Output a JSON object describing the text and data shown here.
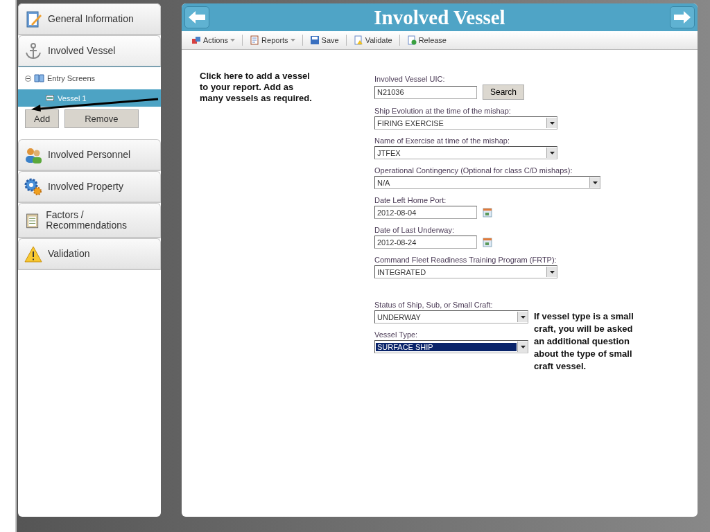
{
  "sidebar": {
    "sections": [
      {
        "label": "General Information",
        "expanded": false
      },
      {
        "label": "Involved Vessel",
        "expanded": true,
        "tree": {
          "label": "Entry Screens",
          "expanded": true,
          "children": [
            {
              "label": "Vessel 1",
              "selected": true
            }
          ]
        },
        "buttons": [
          "Add",
          "Remove"
        ]
      },
      {
        "label": "Involved Personnel",
        "expanded": false
      },
      {
        "label": "Involved Property",
        "expanded": false
      },
      {
        "label": "Factors / Recommendations",
        "expanded": false
      },
      {
        "label": "Validation",
        "expanded": false
      }
    ]
  },
  "header": {
    "title": "Involved Vessel"
  },
  "toolbar": [
    {
      "label": "Actions",
      "dropdown": true
    },
    {
      "label": "Reports",
      "dropdown": true
    },
    {
      "label": "Save",
      "dropdown": false
    },
    {
      "label": "Validate",
      "dropdown": false
    },
    {
      "label": "Release",
      "dropdown": false
    }
  ],
  "callout": "Click here to add a vessel to your report. Add as many vessels as required.",
  "form": {
    "fields": [
      {
        "kind": "search",
        "label": "Involved Vessel UIC:",
        "value": "N21036",
        "button": "Search"
      },
      {
        "kind": "select",
        "label": "Ship Evolution at the time of the mishap:",
        "value": "FIRING EXERCISE",
        "focused": false
      },
      {
        "kind": "select",
        "label": "Name of Exercise at time of the mishap:",
        "value": "JTFEX",
        "focused": false
      },
      {
        "kind": "select",
        "label": "Operational Contingency (Optional for class C/D mishaps):",
        "value": "N/A",
        "focused": false
      },
      {
        "kind": "date",
        "label": "Date Left Home Port:",
        "value": "2012-08-04"
      },
      {
        "kind": "date",
        "label": "Date of Last Underway:",
        "value": "2012-08-24"
      },
      {
        "kind": "select",
        "label": "Command Fleet Readiness Training Program (FRTP):",
        "value": "INTEGRATED",
        "focused": false
      }
    ],
    "group": {
      "fields": [
        {
          "kind": "select",
          "label": "Status of Ship, Sub, or Small Craft:",
          "value": "UNDERWAY",
          "focused": false
        },
        {
          "kind": "select",
          "label": "Vessel Type:",
          "value": "SURFACE SHIP",
          "focused": true
        }
      ],
      "note": "If vessel type is a small craft, you will be asked an additional question about the type of small craft vessel."
    }
  }
}
